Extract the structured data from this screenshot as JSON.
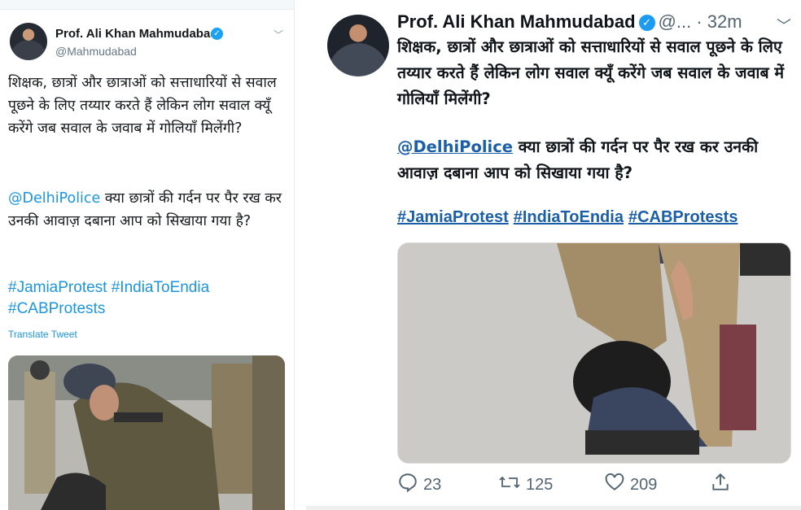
{
  "left_tweet": {
    "name": "Prof. Ali Khan Mahmudabad",
    "handle": "@Mahmudabad",
    "text": "शिक्षक, छात्रों और छात्राओं को सत्ताधारियों से सवाल पूछने के लिए तय्यार करते हैं लेकिन लोग सवाल क्यूँ करेंगे जब सवाल के जवाब में गोलियाँ मिलेंगी?",
    "mention": "@DelhiPolice",
    "mention_text": " क्या छात्रों की गर्दन पर पैर रख कर उनकी आवाज़ दबाना आप को सिखाया गया है?",
    "hashtags": [
      "#JamiaProtest",
      "#IndiaToEndia",
      "#CABProtests"
    ],
    "translate_label": "Translate Tweet"
  },
  "right_tweet": {
    "name": "Prof. Ali Khan Mahmudabad",
    "handle": "@...",
    "time": "· 32m",
    "text": "शिक्षक, छात्रों और छात्राओं को सत्ताधारियों से सवाल पूछने के लिए तय्यार करते हैं लेकिन लोग सवाल क्यूँ करेंगे जब सवाल के जवाब में गोलियाँ मिलेंगी?",
    "mention": "@DelhiPolice",
    "mention_text": " क्या छात्रों की गर्दन पर पैर रख कर उनकी आवाज़ दबाना आप को सिखाया गया है?",
    "hashtags": [
      "#JamiaProtest",
      "#IndiaToEndia",
      "#CABProtests"
    ],
    "stats": {
      "replies": "23",
      "retweets": "125",
      "likes": "209"
    }
  },
  "icons": {
    "verified": "verified-badge-icon",
    "chevron": "chevron-down-icon",
    "reply": "reply-icon",
    "retweet": "retweet-icon",
    "like": "heart-icon",
    "share": "share-icon"
  },
  "colors": {
    "link_light": "#1b95e0",
    "link_dark": "#1a5fa8",
    "verified": "#1d9bf0",
    "muted": "#536471"
  }
}
